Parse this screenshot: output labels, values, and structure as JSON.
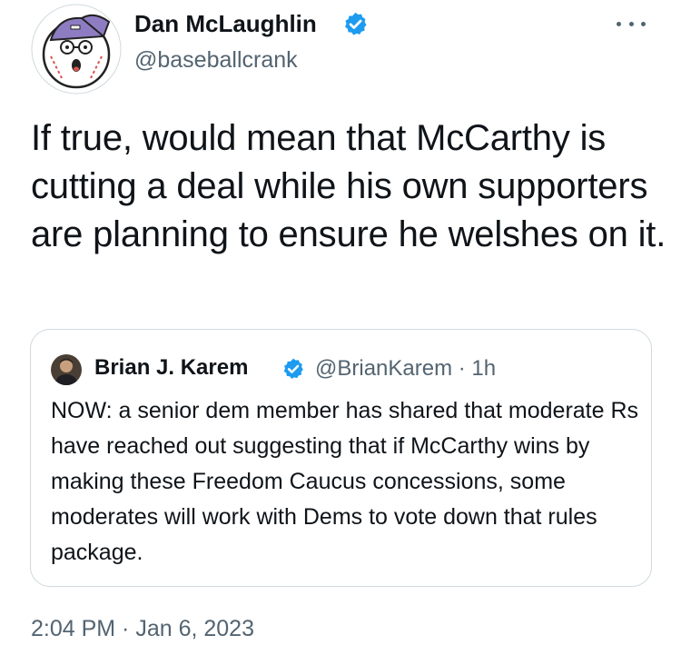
{
  "author": {
    "name": "Dan McLaughlin",
    "handle": "@baseballcrank",
    "verified_color": "#1d9bf0"
  },
  "tweet": {
    "text": "If true, would mean that McCarthy is cutting a deal while his own supporters are planning to ensure he welshes on it.",
    "timestamp": "2:04 PM · Jan 6, 2023"
  },
  "quoted": {
    "name": "Brian J. Karem",
    "handle_time": "@BrianKarem · 1h",
    "text": "NOW: a senior dem member has shared that moderate Rs have reached out suggesting that if McCarthy wins by making these Freedom Caucus concessions, some moderates will work with Dems to vote down that rules package."
  },
  "icons": {
    "more": "more-horizontal-icon",
    "verified": "verified-badge-icon"
  }
}
